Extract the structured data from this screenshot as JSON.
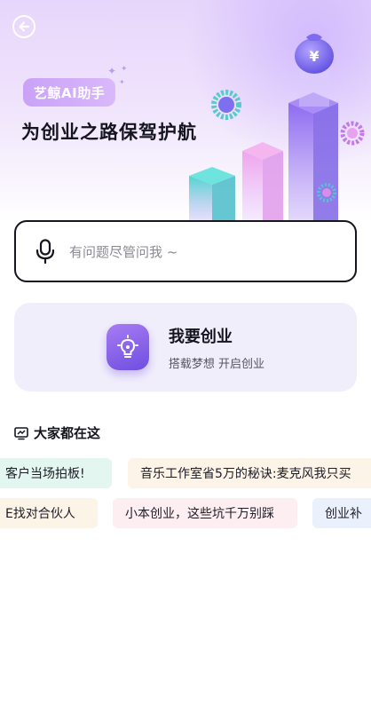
{
  "hero": {
    "badge": "艺鲸AI助手",
    "title": "为创业之路保驾护航"
  },
  "search": {
    "placeholder": "有问题尽管问我 ~"
  },
  "card": {
    "title": "我要创业",
    "subtitle": "搭载梦想 开启创业"
  },
  "section": {
    "title": "大家都在这"
  },
  "chips": {
    "row1": [
      {
        "text": "客户当场拍板!",
        "bg": "#e3f6ef"
      },
      {
        "text": "音乐工作室省5万的秘诀:麦克风我只买",
        "bg": "#fdf4e8"
      }
    ],
    "row2": [
      {
        "text": "E找对合伙人",
        "bg": "#fdf4e8"
      },
      {
        "text": "小本创业，这些坑千万别踩",
        "bg": "#fdeef2"
      },
      {
        "text": "创业补",
        "bg": "#eaf1fc"
      }
    ]
  },
  "colors": {
    "accent": "#7c5be6",
    "hero_bg": "#e7d6fb",
    "card_bg": "#f1eefc"
  },
  "icons": {
    "back": "back-arrow-circle-icon",
    "mic": "microphone-icon",
    "bulb": "lightbulb-icon",
    "section": "monitor-chart-icon"
  }
}
